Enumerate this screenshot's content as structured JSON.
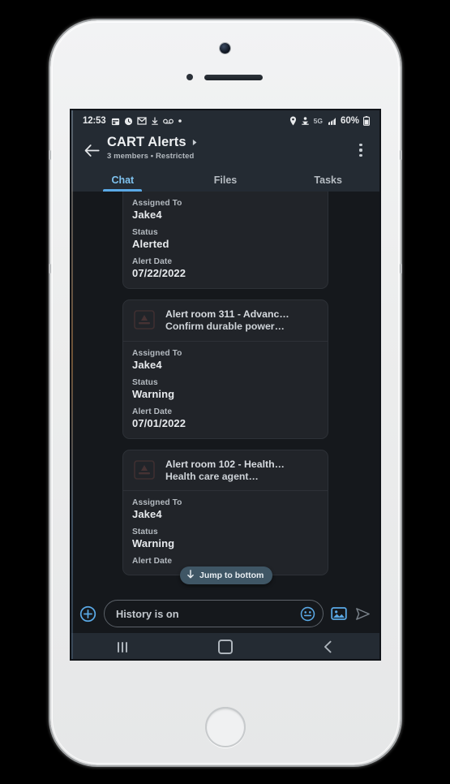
{
  "status_bar": {
    "clock": "12:53",
    "left_icons": [
      "calendar-icon",
      "clock-icon",
      "gmail-icon",
      "download-icon",
      "voicemail-icon",
      "dot-icon"
    ],
    "network_label": "5G",
    "battery_percent": "60%",
    "right_icons": [
      "location-pin-icon",
      "hotspot-icon",
      "signal-bars-icon",
      "battery-icon"
    ]
  },
  "app_bar": {
    "back_icon": "back-arrow-icon",
    "title": "CART Alerts",
    "title_chevron": "chevron-right-icon",
    "subtitle": "3 members  •  Restricted",
    "overflow_icon": "overflow-menu-icon"
  },
  "tabs": [
    {
      "label": "Chat",
      "active": true
    },
    {
      "label": "Files",
      "active": false
    },
    {
      "label": "Tasks",
      "active": false
    }
  ],
  "chat": {
    "cards": [
      {
        "partial_top": true,
        "title": "",
        "subtitle": "",
        "fields": [
          {
            "label": "Assigned To",
            "value": "Jake4"
          },
          {
            "label": "Status",
            "value": "Alerted"
          },
          {
            "label": "Alert Date",
            "value": "07/22/2022"
          }
        ]
      },
      {
        "partial_top": false,
        "title": "Alert room 311 - Advanc…",
        "subtitle": "Confirm durable power…",
        "thumb_icon": "alert-card-thumbnail-icon",
        "fields": [
          {
            "label": "Assigned To",
            "value": "Jake4"
          },
          {
            "label": "Status",
            "value": "Warning"
          },
          {
            "label": "Alert Date",
            "value": "07/01/2022"
          }
        ]
      },
      {
        "partial_top": false,
        "title": "Alert room 102 - Health…",
        "subtitle": "Health care agent…",
        "thumb_icon": "alert-card-thumbnail-icon",
        "fields": [
          {
            "label": "Assigned To",
            "value": "Jake4"
          },
          {
            "label": "Status",
            "value": "Warning"
          },
          {
            "label": "Alert Date",
            "value": ""
          }
        ]
      }
    ],
    "jump_to_bottom": {
      "label": "Jump to bottom",
      "icon": "arrow-down-icon"
    }
  },
  "composer": {
    "plus_icon": "add-circle-icon",
    "input_value": "",
    "input_placeholder": "History is on",
    "emoji_icon": "emoji-smiley-icon",
    "gallery_icon": "image-picker-icon",
    "send_icon": "send-arrow-icon"
  },
  "system_nav": {
    "recents_icon": "recents-icon",
    "home_icon": "home-icon",
    "back_icon": "nav-back-icon"
  },
  "colors": {
    "accent_blue": "#5aa9e6",
    "chat_background": "#15181c",
    "card_background": "#212429",
    "bar_background": "#242b33",
    "pill_background": "#3f5665"
  }
}
